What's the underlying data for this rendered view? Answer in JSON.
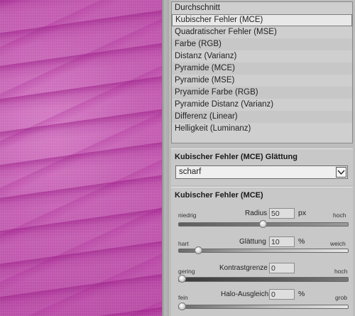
{
  "method_list": {
    "items": [
      "Durchschnitt",
      "Kubischer Fehler (MCE)",
      "Quadratischer Fehler (MSE)",
      "Farbe (RGB)",
      "Distanz (Varianz)",
      "Pyramide (MCE)",
      "Pyramide (MSE)",
      "Pryamide Farbe (RGB)",
      "Pyramide Distanz (Varianz)",
      "Differenz (Linear)",
      "Helligkeit (Luminanz)"
    ],
    "selected": "Kubischer Fehler (MCE)"
  },
  "smoothing": {
    "title": "Kubischer Fehler (MCE) Glättung",
    "value": "scharf"
  },
  "params": {
    "title": "Kubischer Fehler (MCE)",
    "radius": {
      "left": "niedrig",
      "label": "Radius",
      "value": "50",
      "unit": "px",
      "right": "hoch",
      "level": 0.5
    },
    "smoothing": {
      "left": "hart",
      "label": "Glättung",
      "value": "10",
      "unit": "%",
      "right": "weich",
      "level": 0.1
    },
    "contrast": {
      "left": "gering",
      "label": "Kontrastgrenze",
      "value": "0",
      "right": "hoch",
      "level": 0.0
    },
    "halo": {
      "left": "fein",
      "label": "Halo-Ausgleich",
      "value": "0",
      "unit": "%",
      "right": "grob",
      "level": 0.0
    }
  },
  "colors": {
    "panel": "#bdbdbd",
    "selected_row": "#e8e8e8",
    "preview_magenta": "#c560b3"
  }
}
